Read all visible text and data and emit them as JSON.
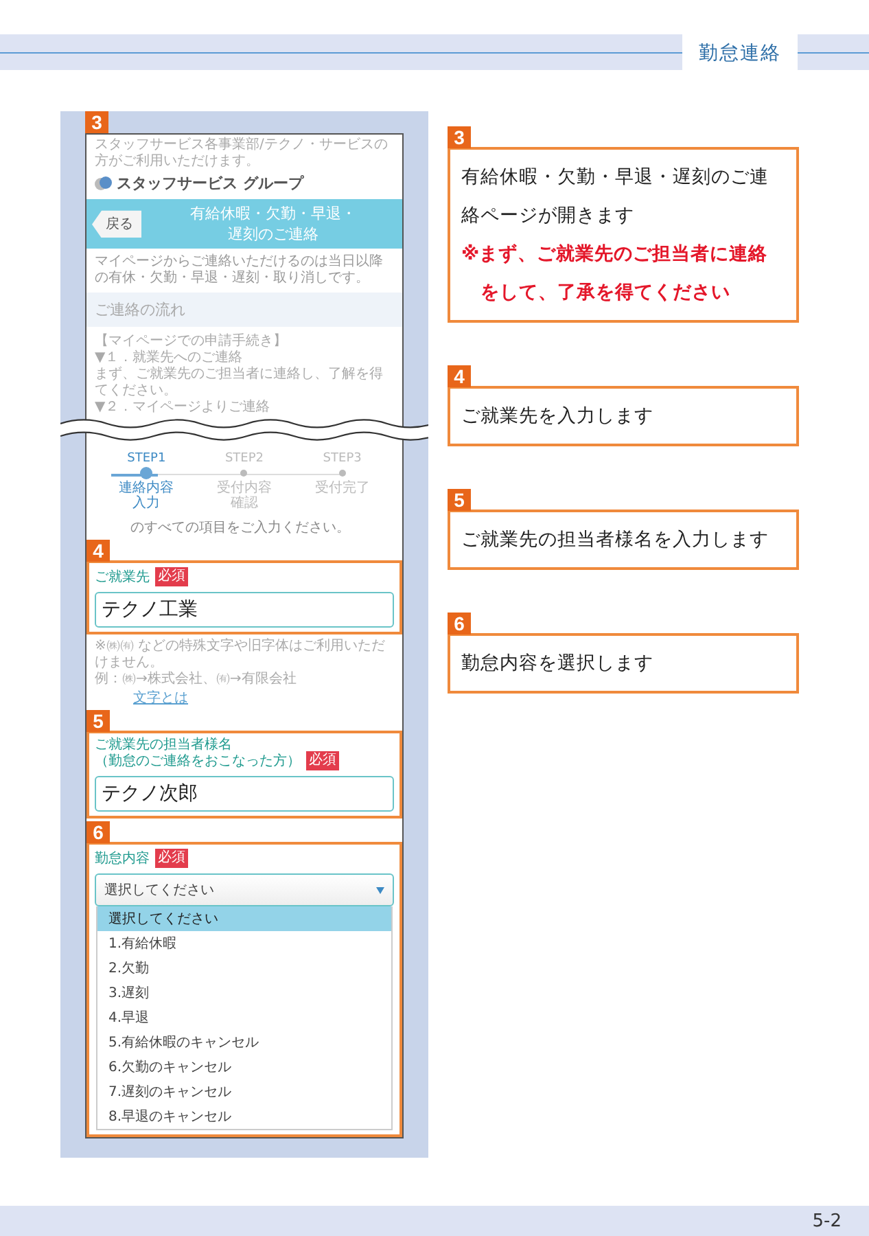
{
  "header": {
    "section": "勤怠連絡"
  },
  "phone": {
    "badge": "3",
    "notice": "スタッフサービス各事業部/テクノ・サービスの方がご利用いただけます。",
    "logo": "スタッフサービス グループ",
    "back_button": "戻る",
    "title_lines": [
      "有給休暇・欠勤・早退・",
      "遅刻のご連絡"
    ],
    "intro": "マイページからご連絡いただけるのは当日以降の有休・欠勤・早退・遅刻・取り消しです。",
    "flow_heading": "ご連絡の流れ",
    "procedure_heading": "【マイページでの申請手続き】",
    "procedure_steps": [
      {
        "title": "▼１．就業先へのご連絡",
        "text": "まず、ご就業先のご担当者に連絡し、了解を得てください。"
      },
      {
        "title": "▼２．マイページよりご連絡"
      }
    ],
    "steps": [
      {
        "label": "STEP1",
        "caption_lines": [
          "連絡内容",
          "入力"
        ],
        "selected": true
      },
      {
        "label": "STEP2",
        "caption_lines": [
          "受付内容",
          "確認"
        ],
        "selected": false
      },
      {
        "label": "STEP3",
        "caption_lines": [
          "受付完了"
        ],
        "selected": false
      }
    ],
    "instruction": "のすべての項目をご入力ください。",
    "fields": [
      {
        "badge": "4",
        "label_lines": [
          "ご就業先"
        ],
        "required": "必須",
        "value": "テクノ工業"
      },
      {
        "badge": "5",
        "label_lines": [
          "ご就業先の担当者様名",
          "（勤怠のご連絡をおこなった方）"
        ],
        "required": "必須",
        "value": "テクノ次郎"
      }
    ],
    "note_lines": [
      "※㈱㈲ などの特殊文字や旧字体はご利用いただけません。",
      "例：㈱→株式会社、㈲→有限会社"
    ],
    "note_link": "文字とは",
    "select": {
      "badge": "6",
      "label": "勤怠内容",
      "required": "必須",
      "value": "選択してください",
      "options": [
        {
          "text": "選択してください",
          "selected": true
        },
        {
          "text": "1.有給休暇",
          "selected": false
        },
        {
          "text": "2.欠勤",
          "selected": false
        },
        {
          "text": "3.遅刻",
          "selected": false
        },
        {
          "text": "4.早退",
          "selected": false
        },
        {
          "text": "5.有給休暇のキャンセル",
          "selected": false
        },
        {
          "text": "6.欠勤のキャンセル",
          "selected": false
        },
        {
          "text": "7.遅刻のキャンセル",
          "selected": false
        },
        {
          "text": "8.早退のキャンセル",
          "selected": false
        }
      ]
    }
  },
  "callouts": [
    {
      "badge": "3",
      "lines": [
        {
          "kind": "plain",
          "text": "有給休暇・欠勤・早退・遅刻のご連絡ページが開きます"
        },
        {
          "kind": "warning",
          "text": "※まず、ご就業先のご担当者に連絡をして、了承を得てください"
        }
      ]
    },
    {
      "badge": "4",
      "lines": [
        {
          "kind": "plain",
          "text": "ご就業先を入力します"
        }
      ]
    },
    {
      "badge": "5",
      "lines": [
        {
          "kind": "plain",
          "text": "ご就業先の担当者様名を入力します"
        }
      ]
    },
    {
      "badge": "6",
      "lines": [
        {
          "kind": "plain",
          "text": "勤怠内容を選択します"
        }
      ]
    }
  ],
  "footer": {
    "page": "5-2"
  }
}
